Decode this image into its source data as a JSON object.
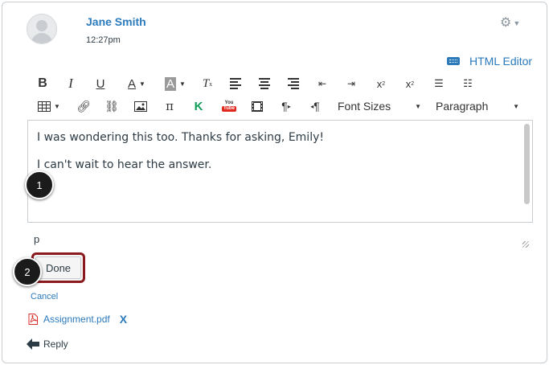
{
  "post": {
    "author": "Jane Smith",
    "time": "12:27pm"
  },
  "editor": {
    "html_editor_label": "HTML Editor",
    "font_sizes_label": "Font Sizes",
    "paragraph_label": "Paragraph",
    "content_lines": [
      "I was wondering this too. Thanks for asking, Emily!",
      "I can't wait to hear the answer."
    ],
    "status_path": "p"
  },
  "toolbar": {
    "row1": [
      "bold-icon",
      "italic-icon",
      "underline-icon",
      "text-color-icon",
      "background-color-icon",
      "clear-formatting-icon",
      "align-left-icon",
      "align-center-icon",
      "align-right-icon",
      "outdent-icon",
      "indent-icon",
      "superscript-icon",
      "subscript-icon",
      "bullet-list-icon",
      "numbered-list-icon"
    ],
    "row2": [
      "table-icon",
      "link-icon",
      "unlink-icon",
      "image-icon",
      "equation-icon",
      "kaltura-icon",
      "youtube-icon",
      "media-icon",
      "ltr-icon",
      "rtl-icon"
    ]
  },
  "actions": {
    "done_label": "Done",
    "cancel_label": "Cancel",
    "reply_label": "Reply"
  },
  "attachment": {
    "filename": "Assignment.pdf",
    "remove_label": "X"
  },
  "callouts": [
    "1",
    "2"
  ],
  "colors": {
    "link": "#2b7abc",
    "done_border": "#8b1a1f",
    "pdf": "#d9302c",
    "youtube": "#e02a20",
    "kaltura": "#0f9d58"
  }
}
